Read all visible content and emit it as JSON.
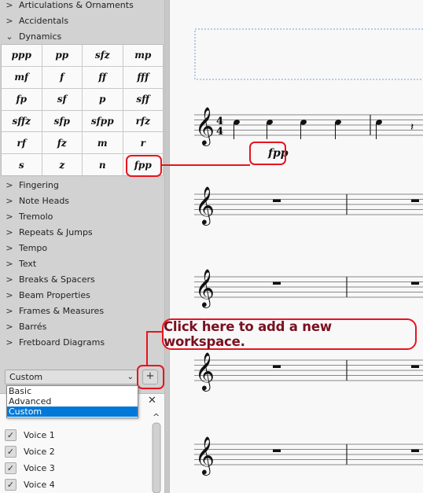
{
  "palette": {
    "sections_top": [
      {
        "label": "Articulations & Ornaments",
        "state": "collapsed"
      },
      {
        "label": "Accidentals",
        "state": "collapsed"
      },
      {
        "label": "Dynamics",
        "state": "expanded"
      }
    ],
    "dynamics": [
      "ppp",
      "pp",
      "sfz",
      "mp",
      "mf",
      "f",
      "ff",
      "fff",
      "fp",
      "sf",
      "p",
      "sff",
      "sffz",
      "sfp",
      "sfpp",
      "rfz",
      "rf",
      "fz",
      "m",
      "r",
      "s",
      "z",
      "n",
      "fpp"
    ],
    "sections_bottom": [
      "Fingering",
      "Note Heads",
      "Tremolo",
      "Repeats & Jumps",
      "Tempo",
      "Text",
      "Breaks & Spacers",
      "Beam Properties",
      "Frames & Measures",
      "Barrés",
      "Fretboard Diagrams"
    ]
  },
  "workspace": {
    "selected": "Custom",
    "add_label": "+",
    "options": [
      "Basic",
      "Advanced",
      "Custom"
    ]
  },
  "selection_filter": {
    "close": "✕",
    "items": [
      "Voice 1",
      "Voice 2",
      "Voice 3",
      "Voice 4"
    ],
    "checked": true
  },
  "score": {
    "time_signature": [
      "4",
      "4"
    ],
    "dynamic": "fpp"
  },
  "annotation": {
    "text": "Click here to add a new workspace.",
    "color": "#e8141e"
  }
}
